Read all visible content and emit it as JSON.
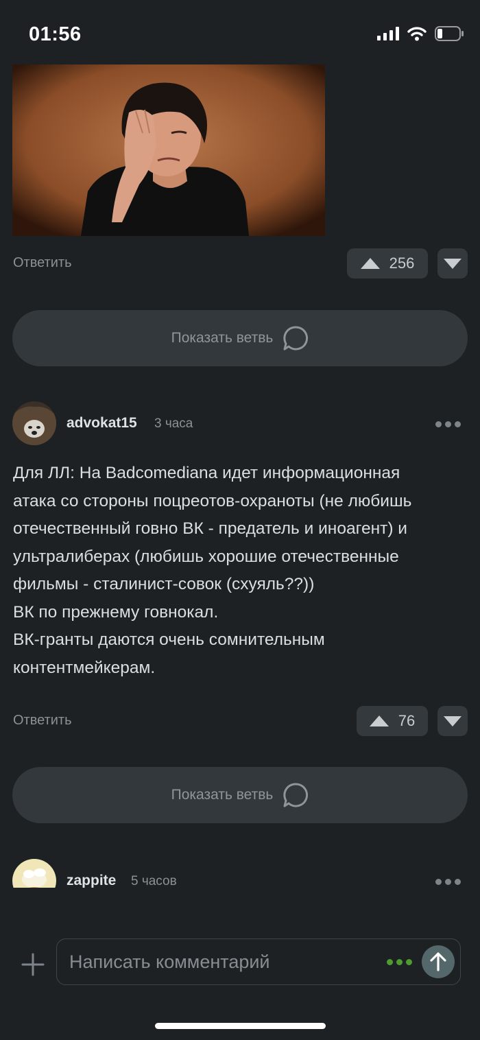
{
  "status_bar": {
    "time": "01:56"
  },
  "comments": [
    {
      "reply_label": "Ответить",
      "upvotes": "256",
      "show_thread_label": "Показать ветвь"
    },
    {
      "username": "advokat15",
      "time_ago": "3 часа",
      "text_lines": [
        "Для ЛЛ: На Badcomediana идет информационная",
        "атака со стороны поцреотов-охраноты (не любишь",
        "отечественный говно ВК - предатель и иноагент) и",
        "ультралиберах (любишь хорошие отечественные",
        "фильмы - сталинист-совок (схуяль??))",
        "ВК по прежнему говнокал.",
        "ВК-гранты даются очень сомнительным",
        "контентмейкерам."
      ],
      "reply_label": "Ответить",
      "upvotes": "76",
      "show_thread_label": "Показать ветвь"
    },
    {
      "username": "zappite",
      "time_ago": "5 часов"
    }
  ],
  "composer": {
    "placeholder": "Написать комментарий"
  },
  "icons": {
    "status": [
      "signal-icon",
      "wifi-icon",
      "battery-icon"
    ],
    "vote": [
      "arrow-up-icon",
      "arrow-down-icon"
    ],
    "thread": "chat-bubble-icon",
    "menu": "more-dots-icon",
    "composer": [
      "plus-icon",
      "typing-dots-icon",
      "send-arrow-icon"
    ]
  },
  "colors": {
    "background": "#1d2124",
    "button": "#33393d",
    "accent_green": "#4f9c2e",
    "send": "#54686c"
  }
}
